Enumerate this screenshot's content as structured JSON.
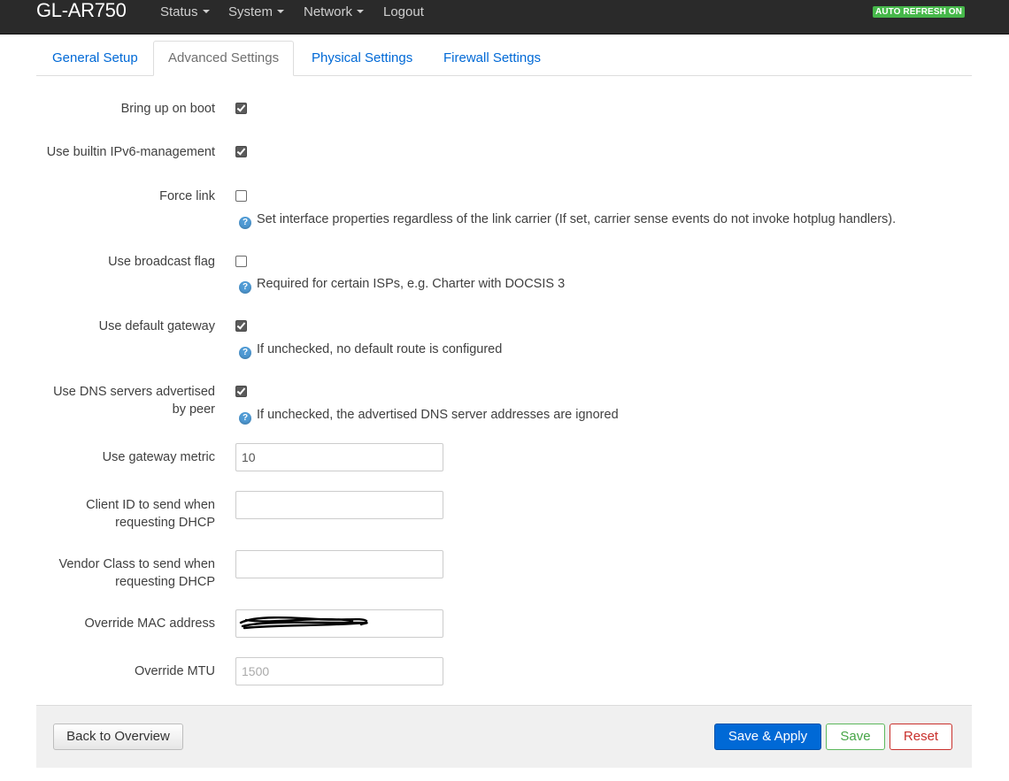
{
  "navbar": {
    "brand": "GL-AR750",
    "items": [
      "Status",
      "System",
      "Network",
      "Logout"
    ],
    "auto_refresh": "AUTO REFRESH ON"
  },
  "tabs": [
    "General Setup",
    "Advanced Settings",
    "Physical Settings",
    "Firewall Settings"
  ],
  "active_tab": "Advanced Settings",
  "fields": {
    "bring_up_on_boot": {
      "label": "Bring up on boot",
      "checked": true
    },
    "ipv6_management": {
      "label": "Use builtin IPv6-management",
      "checked": true
    },
    "force_link": {
      "label": "Force link",
      "checked": false,
      "help": "Set interface properties regardless of the link carrier (If set, carrier sense events do not invoke hotplug handlers)."
    },
    "broadcast_flag": {
      "label": "Use broadcast flag",
      "checked": false,
      "help": "Required for certain ISPs, e.g. Charter with DOCSIS 3"
    },
    "default_gateway": {
      "label": "Use default gateway",
      "checked": true,
      "help": "If unchecked, no default route is configured"
    },
    "peer_dns": {
      "label": "Use DNS servers advertised by peer",
      "checked": true,
      "help": "If unchecked, the advertised DNS server addresses are ignored"
    },
    "gateway_metric": {
      "label": "Use gateway metric",
      "value": "10"
    },
    "client_id": {
      "label": "Client ID to send when requesting DHCP",
      "value": ""
    },
    "vendor_class": {
      "label": "Vendor Class to send when requesting DHCP",
      "value": ""
    },
    "override_mac": {
      "label": "Override MAC address",
      "value": ""
    },
    "override_mtu": {
      "label": "Override MTU",
      "placeholder": "1500"
    }
  },
  "buttons": {
    "back": "Back to Overview",
    "save_apply": "Save & Apply",
    "save": "Save",
    "reset": "Reset"
  },
  "colors": {
    "navbar": "#2a2a2a",
    "link": "#0069d6",
    "badge": "#46b84a",
    "help_icon": "#4f9ad4",
    "primary_button": "#0069d6",
    "save_button": "#46a546",
    "reset_button": "#c9302c"
  },
  "icons": {
    "help": "question-circle-icon",
    "dropdown": "caret-down-icon",
    "checkbox": "checkmark-icon"
  }
}
